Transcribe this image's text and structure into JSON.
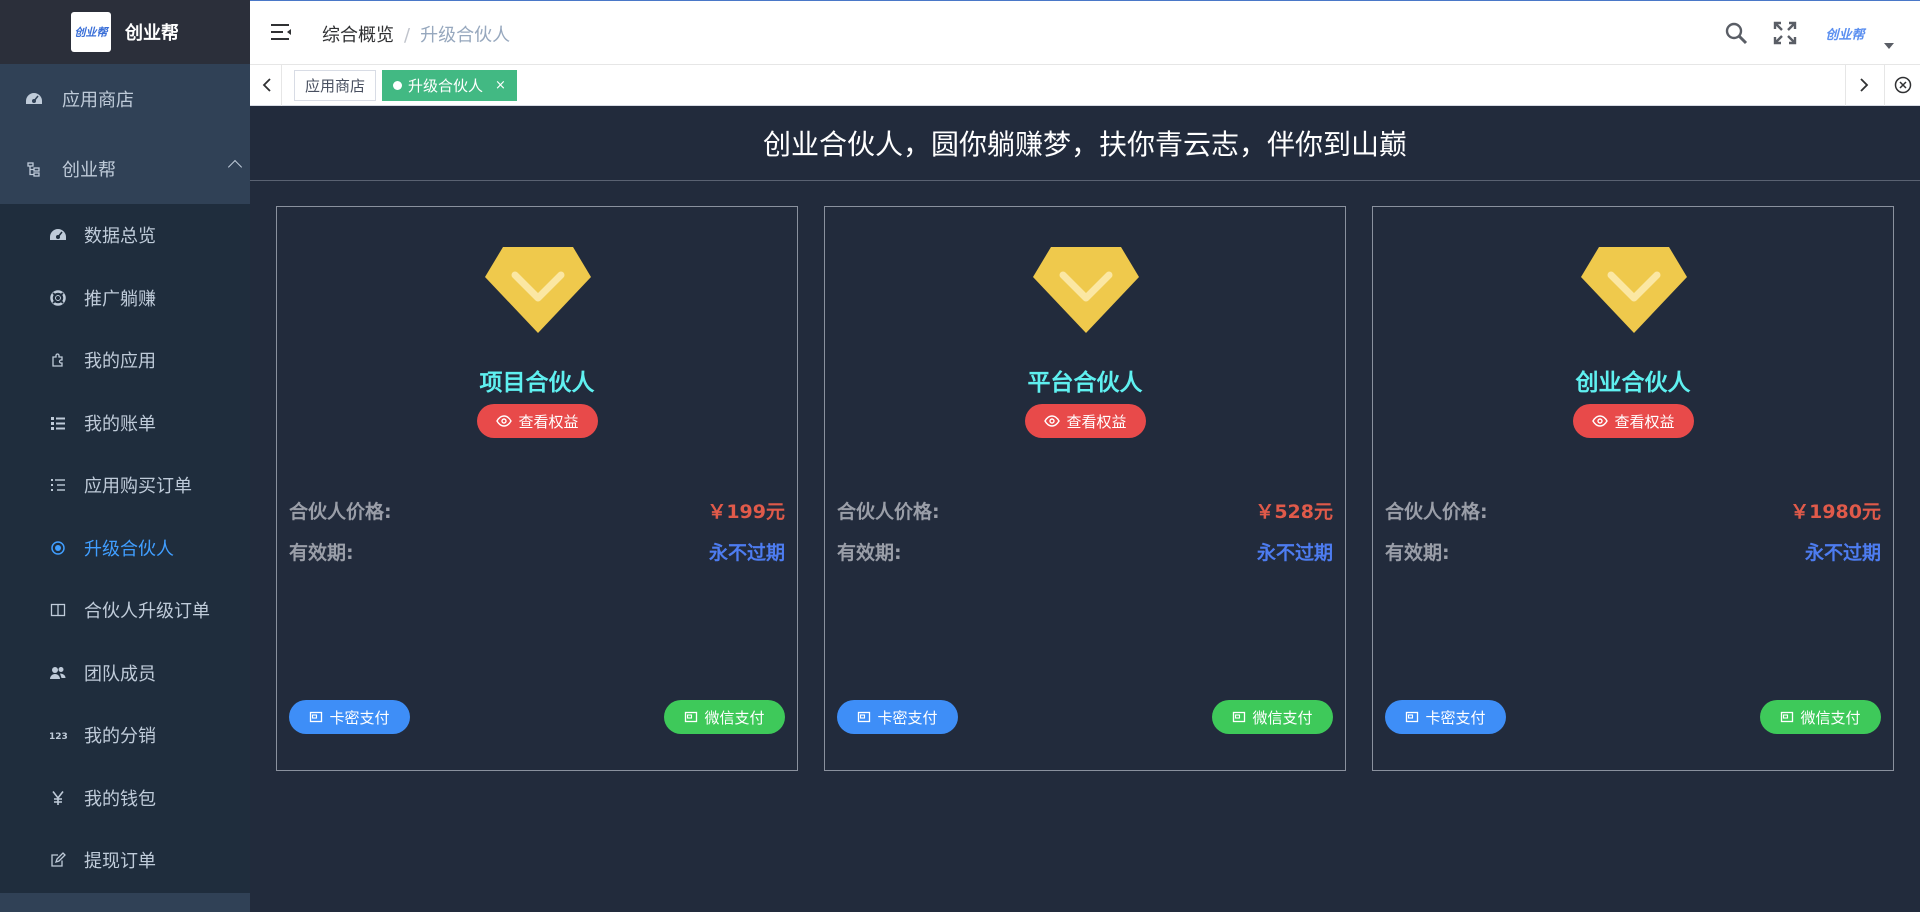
{
  "brand": {
    "logo_text": "创业帮",
    "title": "创业帮"
  },
  "sidebar": {
    "top_items": [
      {
        "label": "应用商店",
        "icon": "dashboard-icon"
      },
      {
        "label": "创业帮",
        "icon": "tree-icon"
      }
    ],
    "sub_items": [
      {
        "label": "数据总览",
        "icon": "dashboard-icon"
      },
      {
        "label": "推广躺赚",
        "icon": "lifebuoy-icon"
      },
      {
        "label": "我的应用",
        "icon": "puzzle-icon"
      },
      {
        "label": "我的账单",
        "icon": "list-icon"
      },
      {
        "label": "应用购买订单",
        "icon": "ordered-list-icon"
      },
      {
        "label": "升级合伙人",
        "icon": "radio-icon",
        "active": true
      },
      {
        "label": "合伙人升级订单",
        "icon": "columns-icon"
      },
      {
        "label": "团队成员",
        "icon": "team-icon"
      },
      {
        "label": "我的分销",
        "icon": "number-icon"
      },
      {
        "label": "我的钱包",
        "icon": "yen-icon"
      },
      {
        "label": "提现订单",
        "icon": "edit-icon"
      }
    ]
  },
  "header": {
    "breadcrumb": [
      "综合概览",
      "升级合伙人"
    ],
    "avatar_text": "创业帮"
  },
  "tags": [
    {
      "label": "应用商店",
      "active": false
    },
    {
      "label": "升级合伙人",
      "active": true,
      "close": "×"
    }
  ],
  "main": {
    "slogan": "创业合伙人，圆你躺赚梦，扶你青云志，伴你到山巅",
    "benefit_label": "查看权益",
    "price_label": "合伙人价格:",
    "validity_label": "有效期:",
    "pay_card_label": "卡密支付",
    "pay_wechat_label": "微信支付",
    "cards": [
      {
        "name": "项目合伙人",
        "price": "￥199元",
        "validity": "永不过期"
      },
      {
        "name": "平台合伙人",
        "price": "￥528元",
        "validity": "永不过期"
      },
      {
        "name": "创业合伙人",
        "price": "￥1980元",
        "validity": "永不过期"
      }
    ]
  },
  "colors": {
    "sidebar_bg": "#1f2d3d",
    "active": "#409eff",
    "tag_active": "#42b983",
    "diamond": "#efc94c",
    "plan_name": "#5ff0f0",
    "price": "#e05a4a",
    "validity": "#4d7cf0",
    "benefit_btn": "#e84a4a",
    "pay_card": "#3e8ef7",
    "pay_wechat": "#3ec95a"
  }
}
